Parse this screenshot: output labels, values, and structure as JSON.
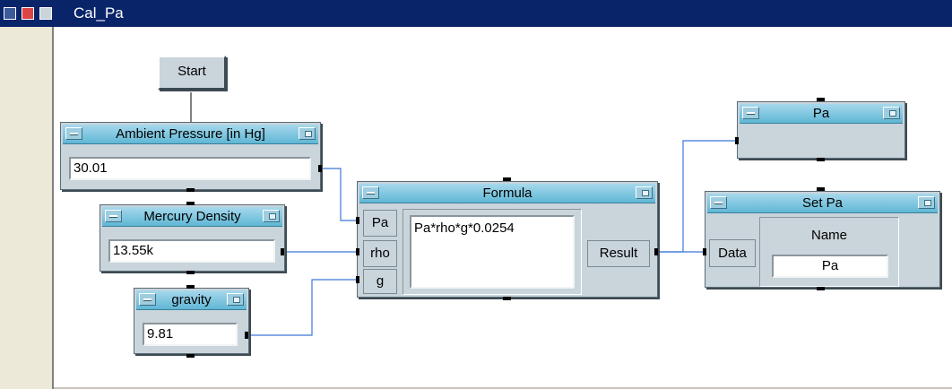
{
  "window": {
    "title": "Cal_Pa"
  },
  "icons": [
    "app-icon",
    "restore-icon",
    "minimize-icon",
    "minimize-object-icon",
    "object-menu-icon"
  ],
  "start_button": {
    "label": "Start"
  },
  "ambient": {
    "title": "Ambient Pressure [in Hg]",
    "value": "30.01"
  },
  "mercury": {
    "title": "Mercury Density",
    "value": "13.55k"
  },
  "gravity": {
    "title": "gravity",
    "value": "9.81"
  },
  "formula": {
    "title": "Formula",
    "inputs": [
      "Pa",
      "rho",
      "g"
    ],
    "expression": "Pa*rho*g*0.0254",
    "output": "Result"
  },
  "pa_display": {
    "title": "Pa"
  },
  "setpa": {
    "title": "Set Pa",
    "input": "Data",
    "name_label": "Name",
    "name_value": "Pa"
  },
  "colors": {
    "titlebar": "#0a246a",
    "object_body": "#c9d4db",
    "object_header": "#5fb7d5",
    "wire": "#3c78d8"
  }
}
